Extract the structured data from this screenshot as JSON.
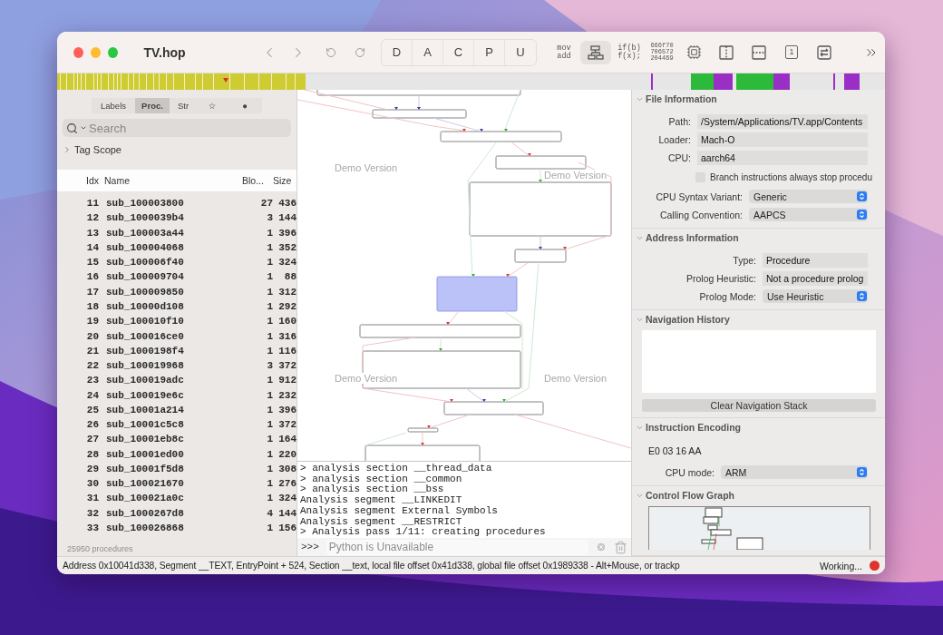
{
  "window": {
    "title": "TV.hop"
  },
  "toolbar": {
    "segments": [
      {
        "label": "D",
        "selected": false
      },
      {
        "label": "A",
        "selected": false
      },
      {
        "label": "C",
        "selected": false
      },
      {
        "label": "P",
        "selected": false
      },
      {
        "label": "U",
        "selected": false
      }
    ],
    "tools": [
      {
        "kind": "text",
        "lines": [
          "mov",
          "add"
        ],
        "selected": false
      },
      {
        "kind": "graph",
        "selected": true
      },
      {
        "kind": "text",
        "lines": [
          "if(b)",
          "f(x);"
        ],
        "selected": false
      },
      {
        "kind": "hex",
        "lines": [
          "666f70",
          "706572",
          "204469"
        ],
        "selected": false
      },
      {
        "kind": "chip",
        "selected": false
      },
      {
        "kind": "columns",
        "selected": false
      },
      {
        "kind": "rows",
        "selected": false
      },
      {
        "kind": "boxed",
        "text": "1",
        "selected": false
      },
      {
        "kind": "sliders",
        "selected": false
      }
    ]
  },
  "sidebar": {
    "tabs": [
      {
        "label": "Labels",
        "selected": false
      },
      {
        "label": "Proc.",
        "selected": true
      },
      {
        "label": "Str",
        "selected": false
      },
      {
        "label": "☆",
        "selected": false
      },
      {
        "label": "●",
        "selected": false
      }
    ],
    "search": {
      "placeholder": "Search"
    },
    "tag_scope": {
      "label": "Tag Scope",
      "expanded": false
    },
    "table": {
      "columns": [
        "Idx",
        "Name",
        "Blo...",
        "Size"
      ],
      "rows": [
        [
          "11",
          "sub_100003800",
          "27",
          "436"
        ],
        [
          "12",
          "sub_1000039b4",
          "3",
          "144"
        ],
        [
          "13",
          "sub_100003a44",
          "1",
          "396"
        ],
        [
          "14",
          "sub_100004068",
          "1",
          "352"
        ],
        [
          "15",
          "sub_100006f40",
          "1",
          "324"
        ],
        [
          "16",
          "sub_100009704",
          "1",
          "88"
        ],
        [
          "17",
          "sub_100009850",
          "1",
          "312"
        ],
        [
          "18",
          "sub_10000d108",
          "1",
          "292"
        ],
        [
          "19",
          "sub_100010f10",
          "1",
          "160"
        ],
        [
          "20",
          "sub_100016ce0",
          "1",
          "316"
        ],
        [
          "21",
          "sub_1000198f4",
          "1",
          "116"
        ],
        [
          "22",
          "sub_100019968",
          "3",
          "372"
        ],
        [
          "23",
          "sub_100019adc",
          "1",
          "912"
        ],
        [
          "24",
          "sub_100019e6c",
          "1",
          "232"
        ],
        [
          "25",
          "sub_10001a214",
          "1",
          "396"
        ],
        [
          "26",
          "sub_10001c5c8",
          "1",
          "372"
        ],
        [
          "27",
          "sub_10001eb8c",
          "1",
          "164"
        ],
        [
          "28",
          "sub_10001ed00",
          "1",
          "220"
        ],
        [
          "29",
          "sub_10001f5d8",
          "1",
          "308"
        ],
        [
          "30",
          "sub_100021670",
          "1",
          "276"
        ],
        [
          "31",
          "sub_100021a0c",
          "1",
          "324"
        ],
        [
          "32",
          "sub_1000267d8",
          "4",
          "144"
        ],
        [
          "33",
          "sub_100026868",
          "1",
          "156"
        ]
      ]
    },
    "footer": "25950 procedures"
  },
  "graph": {
    "overlay_texts": [
      "Demo Version",
      "Demo Version",
      "Demo Version",
      "Demo Version"
    ]
  },
  "console": {
    "lines": [
      "> analysis section __thread_data",
      "> analysis section __common",
      "> analysis section __bss",
      "Analysis segment __LINKEDIT",
      "Analysis segment External Symbols",
      "Analysis segment __RESTRICT",
      "> Analysis pass 1/11: creating procedures"
    ],
    "prompt": ">>>",
    "input": {
      "placeholder": "Python is Unavailable"
    }
  },
  "inspector": [
    {
      "title": "File Information",
      "expanded": true,
      "items": [
        {
          "kind": "field",
          "label": "Path:",
          "value": "/System/Applications/TV.app/Contents"
        },
        {
          "kind": "field",
          "label": "Loader:",
          "value": "Mach-O"
        },
        {
          "kind": "field",
          "label": "CPU:",
          "value": "aarch64"
        },
        {
          "kind": "checkbox",
          "label": "Branch instructions always stop procedu",
          "checked": false
        },
        {
          "kind": "popup",
          "label": "CPU Syntax Variant:",
          "value": "Generic"
        },
        {
          "kind": "popup",
          "label": "Calling Convention:",
          "value": "AAPCS"
        }
      ]
    },
    {
      "title": "Address Information",
      "expanded": true,
      "items": [
        {
          "kind": "field",
          "label": "Type:",
          "value": "Procedure"
        },
        {
          "kind": "field",
          "label": "Prolog Heuristic:",
          "value": "Not a procedure prolog"
        },
        {
          "kind": "popup",
          "label": "Prolog Mode:",
          "value": "Use Heuristic"
        }
      ]
    },
    {
      "title": "Navigation History",
      "expanded": true,
      "items": [
        {
          "kind": "list"
        },
        {
          "kind": "button",
          "label": "Clear Navigation Stack"
        }
      ]
    },
    {
      "title": "Instruction Encoding",
      "expanded": true,
      "items": [
        {
          "kind": "text",
          "text": "E0 03 16 AA"
        },
        {
          "kind": "popup",
          "label": "CPU mode:",
          "value": "ARM"
        }
      ]
    },
    {
      "title": "Control Flow Graph",
      "expanded": true,
      "items": [
        {
          "kind": "minimap"
        }
      ]
    }
  ],
  "status_bar": {
    "text": "Address 0x10041d338, Segment __TEXT, EntryPoint + 524, Section __text, local file offset 0x41d338, global file offset 0x1989338 - Alt+Mouse, or trackp",
    "activity": "Working..."
  }
}
